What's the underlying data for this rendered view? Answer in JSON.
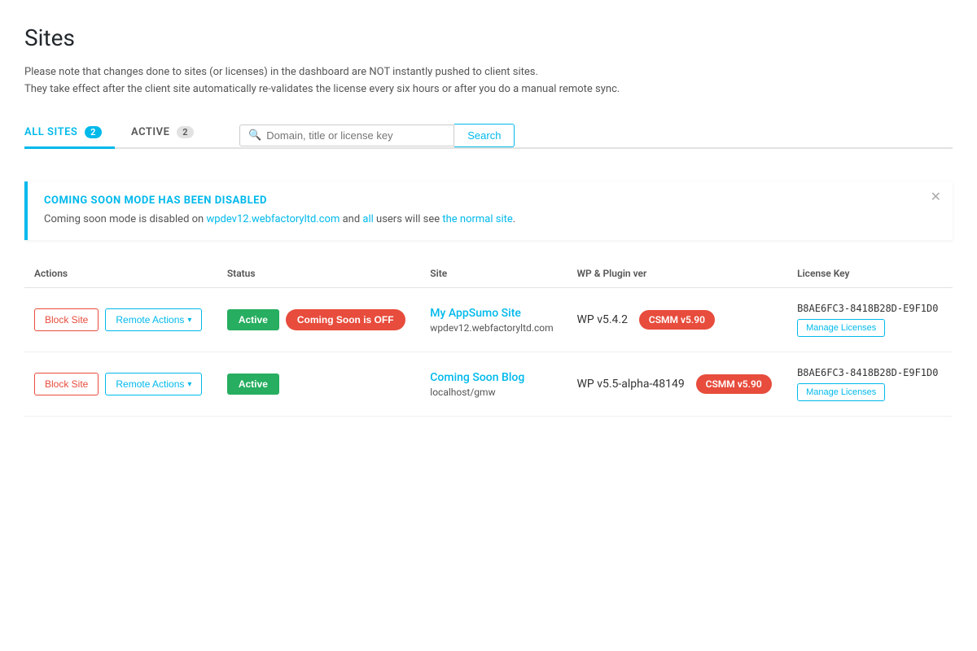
{
  "page": {
    "title": "Sites",
    "description_line1": "Please note that changes done to sites (or licenses) in the dashboard are NOT instantly pushed to client sites.",
    "description_line2": "They take effect after the client site automatically re-validates the license every six hours or after you do a manual remote sync."
  },
  "tabs": [
    {
      "id": "all-sites",
      "label": "ALL SITES",
      "count": "2",
      "active": true
    },
    {
      "id": "active",
      "label": "ACTIVE",
      "count": "2",
      "active": false
    }
  ],
  "search": {
    "placeholder": "Domain, title or license key",
    "button_label": "Search"
  },
  "alert": {
    "title": "COMING SOON MODE HAS BEEN DISABLED",
    "body_text": "Coming soon mode is disabled on wpdev12.webfactoryltd.com and all users will see the normal site.",
    "body_link_words": [
      "wpdev12.webfactoryltd.com",
      "all",
      "the normal site"
    ]
  },
  "table": {
    "columns": [
      "Actions",
      "Status",
      "Site",
      "WP & Plugin ver",
      "License Key"
    ],
    "rows": [
      {
        "id": "row-1",
        "block_site_label": "Block Site",
        "remote_actions_label": "Remote Actions",
        "status_label": "Active",
        "coming_soon_label": "Coming Soon is OFF",
        "site_name": "My AppSumo Site",
        "site_url": "wpdev12.webfactoryltd.com",
        "wp_ver": "WP v5.4.2",
        "plugin_badge": "CSMM v5.90",
        "license_key": "B8AE6FC3-8418B28D-E9F1D0",
        "manage_licenses_label": "Manage Licenses"
      },
      {
        "id": "row-2",
        "block_site_label": "Block Site",
        "remote_actions_label": "Remote Actions",
        "status_label": "Active",
        "coming_soon_label": "",
        "site_name": "Coming Soon Blog",
        "site_url": "localhost/gmw",
        "wp_ver": "WP v5.5-alpha-48149",
        "plugin_badge": "CSMM v5.90",
        "license_key": "B8AE6FC3-8418B28D-E9F1D0",
        "manage_licenses_label": "Manage Licenses"
      }
    ]
  }
}
